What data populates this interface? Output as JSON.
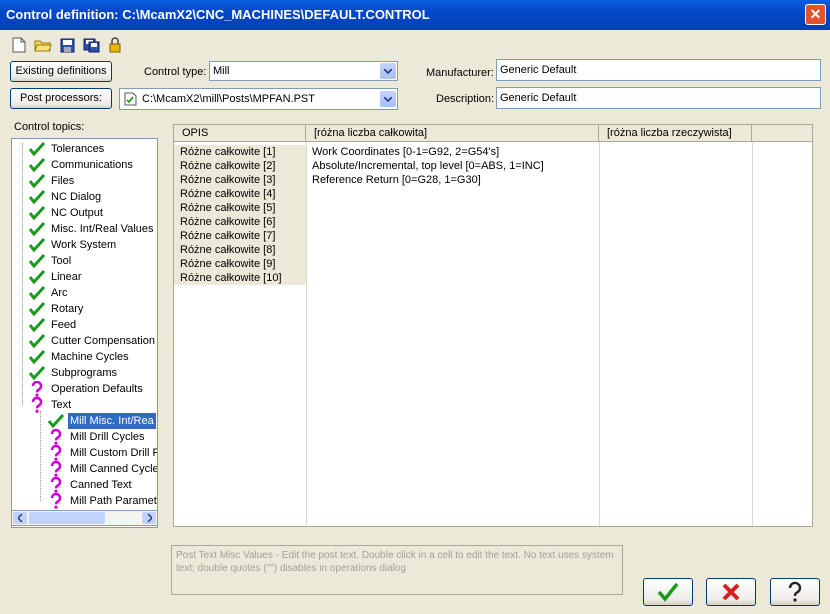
{
  "window": {
    "title": "Control definition: C:\\McamX2\\CNC_MACHINES\\DEFAULT.CONTROL"
  },
  "toolbar": {
    "icons": [
      "new-file-icon",
      "open-folder-icon",
      "save-icon",
      "save-as-icon",
      "lock-icon"
    ]
  },
  "buttons": {
    "existing_definitions": "Existing definitions",
    "post_processors": "Post processors:"
  },
  "control_type": {
    "label": "Control type:",
    "value": "Mill"
  },
  "post_path": {
    "value": "C:\\McamX2\\mill\\Posts\\MPFAN.PST"
  },
  "manufacturer": {
    "label": "Manufacturer:",
    "value": "Generic Default"
  },
  "description": {
    "label": "Description:",
    "value": "Generic Default"
  },
  "control_topics": {
    "label": "Control topics:",
    "items": [
      {
        "label": "Tolerances",
        "status": "check",
        "indent": 0
      },
      {
        "label": "Communications",
        "status": "check",
        "indent": 0
      },
      {
        "label": "Files",
        "status": "check",
        "indent": 0
      },
      {
        "label": "NC Dialog",
        "status": "check",
        "indent": 0
      },
      {
        "label": "NC Output",
        "status": "check",
        "indent": 0
      },
      {
        "label": "Misc. Int/Real Values",
        "status": "check",
        "indent": 0
      },
      {
        "label": "Work System",
        "status": "check",
        "indent": 0
      },
      {
        "label": "Tool",
        "status": "check",
        "indent": 0
      },
      {
        "label": "Linear",
        "status": "check",
        "indent": 0
      },
      {
        "label": "Arc",
        "status": "check",
        "indent": 0
      },
      {
        "label": "Rotary",
        "status": "check",
        "indent": 0
      },
      {
        "label": "Feed",
        "status": "check",
        "indent": 0
      },
      {
        "label": "Cutter Compensation",
        "status": "check",
        "indent": 0
      },
      {
        "label": "Machine Cycles",
        "status": "check",
        "indent": 0
      },
      {
        "label": "Subprograms",
        "status": "check",
        "indent": 0
      },
      {
        "label": "Operation Defaults",
        "status": "question",
        "indent": 0
      },
      {
        "label": "Text",
        "status": "question",
        "indent": 0
      },
      {
        "label": "Mill Misc. Int/Rea",
        "status": "check",
        "indent": 1,
        "selected": true
      },
      {
        "label": "Mill Drill Cycles",
        "status": "question",
        "indent": 1
      },
      {
        "label": "Mill Custom Drill P",
        "status": "question",
        "indent": 1
      },
      {
        "label": "Mill Canned Cycle",
        "status": "question",
        "indent": 1
      },
      {
        "label": "Canned Text",
        "status": "question",
        "indent": 1
      },
      {
        "label": "Mill Path Paramete",
        "status": "question",
        "indent": 1
      }
    ]
  },
  "grid": {
    "headers": [
      "OPIS",
      "[różna liczba całkowita]",
      "[różna liczba rzeczywista]"
    ],
    "rows": [
      {
        "label": "Różne całkowite [1]",
        "value": "Work Coordinates [0-1=G92, 2=G54's]"
      },
      {
        "label": "Różne całkowite [2]",
        "value": "Absolute/Incremental, top level [0=ABS, 1=INC]"
      },
      {
        "label": "Różne całkowite [3]",
        "value": "Reference Return [0=G28, 1=G30]"
      },
      {
        "label": "Różne całkowite [4]",
        "value": ""
      },
      {
        "label": "Różne całkowite [5]",
        "value": ""
      },
      {
        "label": "Różne całkowite [6]",
        "value": ""
      },
      {
        "label": "Różne całkowite [7]",
        "value": ""
      },
      {
        "label": "Różne całkowite [8]",
        "value": ""
      },
      {
        "label": "Różne całkowite [9]",
        "value": ""
      },
      {
        "label": "Różne całkowite [10]",
        "value": ""
      }
    ]
  },
  "help_text": "Post Text Misc Values - Edit the post text.  Double click in a cell to edit the text.  No text uses system text; double quotes (\"\") disables in operations dialog",
  "colors": {
    "check": "#1a9a1a",
    "question": "#d400d4",
    "selected": "#316ac5"
  }
}
